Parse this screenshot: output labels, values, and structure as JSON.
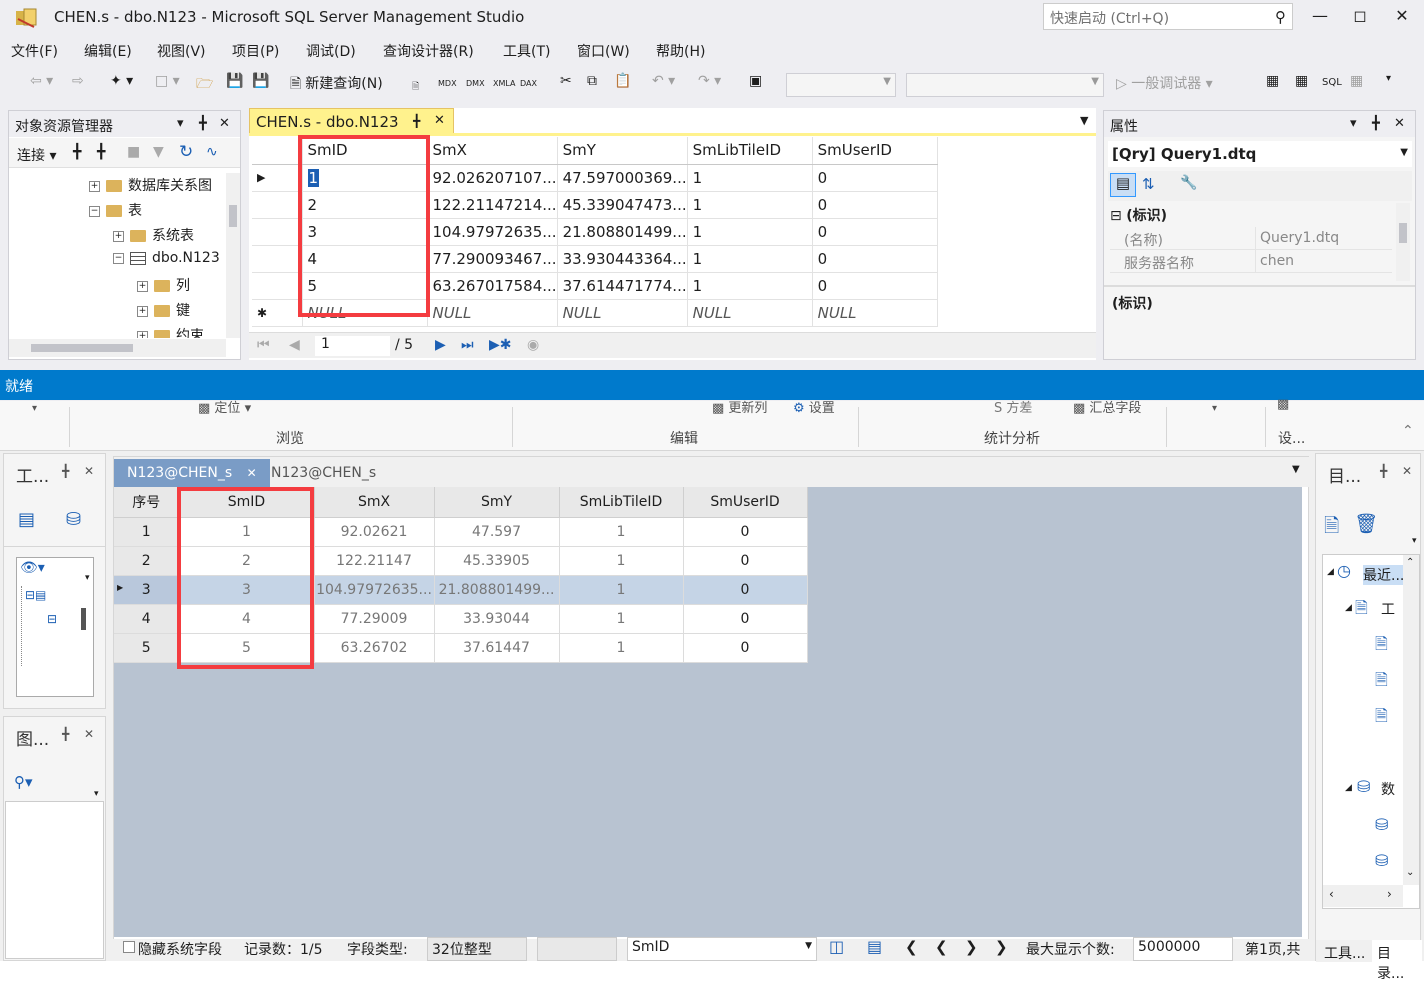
{
  "window": {
    "title": "CHEN.s - dbo.N123 - Microsoft SQL Server Management Studio",
    "quick_launch_placeholder": "快速启动 (Ctrl+Q)"
  },
  "menu": [
    "文件(F)",
    "编辑(E)",
    "视图(V)",
    "项目(P)",
    "调试(D)",
    "查询设计器(R)",
    "工具(T)",
    "窗口(W)",
    "帮助(H)"
  ],
  "toolbar": {
    "new_query": "新建查询(N)",
    "debugger": "一般调试器",
    "icons": [
      "MDX",
      "DMX",
      "XMLA",
      "DAX"
    ]
  },
  "object_explorer": {
    "title": "对象资源管理器",
    "connect": "连接",
    "tree": [
      "数据库关系图",
      "表",
      "系统表",
      "dbo.N123",
      "列",
      "键",
      "约束"
    ]
  },
  "document": {
    "tab": "CHEN.s - dbo.N123",
    "columns": [
      "SmID",
      "SmX",
      "SmY",
      "SmLibTileID",
      "SmUserID"
    ],
    "rows": [
      [
        "1",
        "92.026207107...",
        "47.597000369...",
        "1",
        "0"
      ],
      [
        "2",
        "122.21147214...",
        "45.339047473...",
        "1",
        "0"
      ],
      [
        "3",
        "104.97972635...",
        "21.808801499...",
        "1",
        "0"
      ],
      [
        "4",
        "77.290093467...",
        "33.930443364...",
        "1",
        "0"
      ],
      [
        "5",
        "63.267017584...",
        "37.614471774...",
        "1",
        "0"
      ]
    ],
    "null_label": "NULL",
    "nav_current": "1",
    "nav_total": "/ 5"
  },
  "properties": {
    "title": "属性",
    "object": "[Qry] Query1.dtq",
    "section": "(标识)",
    "items": [
      {
        "name": "(名称)",
        "value": "Query1.dtq"
      },
      {
        "name": "服务器名称",
        "value": "chen"
      }
    ],
    "description": "(标识)"
  },
  "status": "就绪",
  "ribbon": {
    "groups": [
      "浏览",
      "编辑",
      "统计分析",
      "设..."
    ],
    "items": [
      "定位",
      "更新列",
      "设置",
      "方差",
      "汇总字段"
    ]
  },
  "left_panels": {
    "workspace_title": "工...",
    "layer_title": "图..."
  },
  "right_panel": {
    "title": "目...",
    "tree": [
      "最近...",
      "工",
      "数"
    ],
    "bottom_tabs": [
      "工具...",
      "目录..."
    ]
  },
  "center": {
    "tabs": [
      "N123@CHEN_s",
      "N123@CHEN_s"
    ],
    "columns": [
      "序号",
      "SmID",
      "SmX",
      "SmY",
      "SmLibTileID",
      "SmUserID"
    ],
    "rows": [
      [
        "1",
        "1",
        "92.02621",
        "47.597",
        "1",
        "0"
      ],
      [
        "2",
        "2",
        "122.21147",
        "45.33905",
        "1",
        "0"
      ],
      [
        "3",
        "3",
        "104.97972635...",
        "21.808801499...",
        "1",
        "0"
      ],
      [
        "4",
        "4",
        "77.29009",
        "33.93044",
        "1",
        "0"
      ],
      [
        "5",
        "5",
        "63.26702",
        "37.61447",
        "1",
        "0"
      ]
    ],
    "selected_row": 3
  },
  "bottom_status": {
    "hide_system_fields": "隐藏系统字段",
    "record_count": "记录数：1/5",
    "field_type_label": "字段类型:",
    "field_type_value": "32位整型",
    "field_select": "SmID",
    "max_display_label": "最大显示个数:",
    "max_display_value": "5000000",
    "page": "第1页,共"
  }
}
